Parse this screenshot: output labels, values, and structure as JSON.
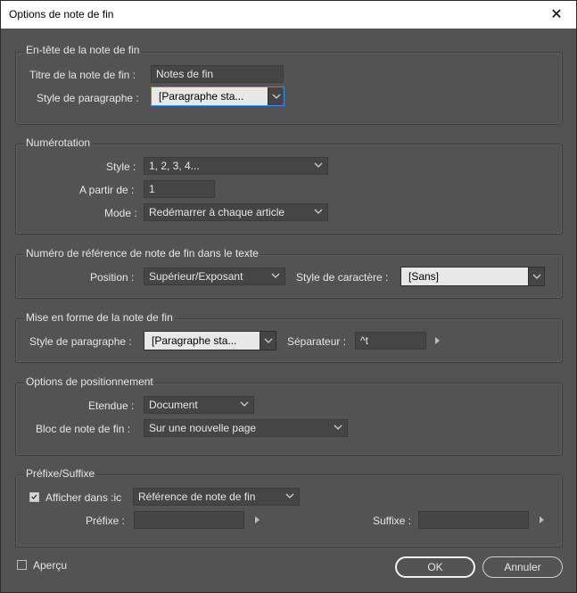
{
  "window": {
    "title": "Options de note de fin",
    "close_glyph": "✕"
  },
  "header_group": {
    "legend": "En-tête de la note de fin",
    "title_label": "Titre de la note de fin :",
    "title_value": "Notes de fin",
    "para_style_label": "Style de paragraphe :",
    "para_style_value": "[Paragraphe sta..."
  },
  "numbering_group": {
    "legend": "Numérotation",
    "style_label": "Style :",
    "style_value": "1, 2, 3, 4...",
    "start_label": "A partir de :",
    "start_value": "1",
    "mode_label": "Mode :",
    "mode_value": "Redémarrer à chaque article"
  },
  "reference_group": {
    "legend": "Numéro de référence de note de fin dans le texte",
    "position_label": "Position :",
    "position_value": "Supérieur/Exposant",
    "char_style_label": "Style de caractère :",
    "char_style_value": "[Sans]"
  },
  "format_group": {
    "legend": "Mise en forme de la note de fin",
    "para_style_label": "Style de paragraphe :",
    "para_style_value": "[Paragraphe sta...",
    "separator_label": "Séparateur :",
    "separator_value": "^t"
  },
  "positioning_group": {
    "legend": "Options de positionnement",
    "scope_label": "Etendue :",
    "scope_value": "Document",
    "frame_label": "Bloc de note de fin :",
    "frame_value": "Sur une nouvelle page"
  },
  "prefix_group": {
    "legend": "Préfixe/Suffixe",
    "show_in_label": "Afficher dans :ic",
    "show_in_checked": true,
    "show_in_value": "Référence de note de fin",
    "prefix_label": "Préfixe :",
    "prefix_value": "",
    "suffix_label": "Suffixe :",
    "suffix_value": ""
  },
  "footer": {
    "preview_label": "Aperçu",
    "preview_checked": false,
    "ok_label": "OK",
    "cancel_label": "Annuler"
  }
}
